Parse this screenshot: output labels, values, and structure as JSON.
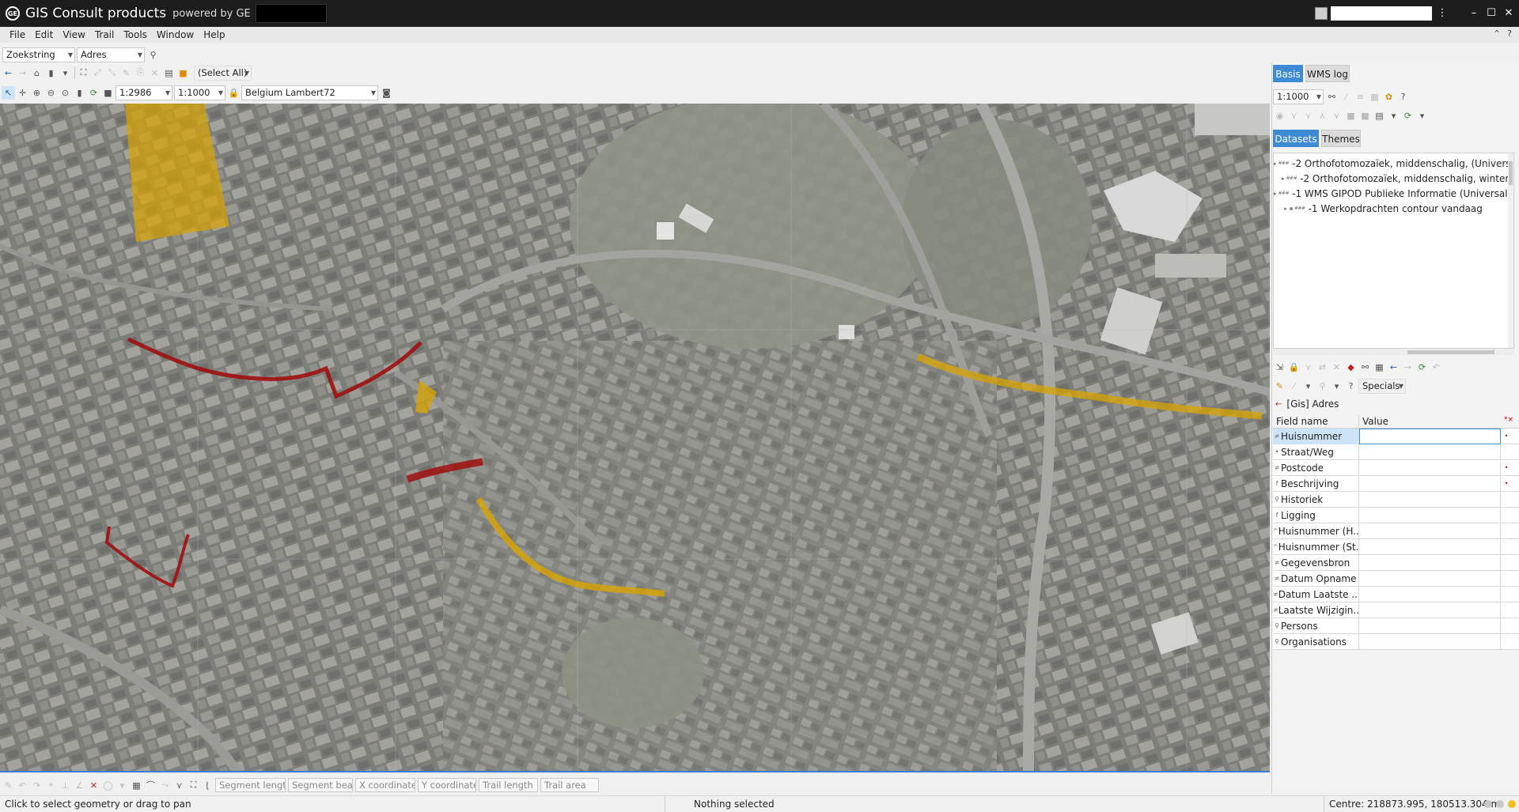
{
  "titlebar": {
    "app_title": "GIS Consult products",
    "powered_by": "powered by GE",
    "logo_text": "GE"
  },
  "menu": [
    "File",
    "Edit",
    "View",
    "Trail",
    "Tools",
    "Window",
    "Help"
  ],
  "search": {
    "field_value": "Zoekstring",
    "type_value": "Adres"
  },
  "toolbar": {
    "select_all": "(Select All)",
    "scale_value": "1:2986",
    "scale_preset": "1:1000",
    "crs": "Belgium Lambert72"
  },
  "bottom_toolbar": {
    "segment_length": "Segment lengtl",
    "segment_bearing": "Segment beari",
    "x_coordinate": "X coordinate",
    "y_coordinate": "Y coordinate",
    "trail_length": "Trail length",
    "trail_area": "Trail area"
  },
  "statusbar": {
    "hint": "Click to select geometry or drag to pan",
    "selection": "Nothing selected",
    "center": "Centre: 218873.995, 180513.304 m"
  },
  "right_panel": {
    "tabs": [
      "Basis",
      "WMS log"
    ],
    "scale": "1:1000",
    "subtabs": [
      "Datasets",
      "Themes"
    ],
    "tree_items": [
      {
        "label": "-2 Orthofotomozaïek, middenschalig, (Universal",
        "level": 0
      },
      {
        "label": "-2 Orthofotomozaïek, middenschalig, winterop",
        "level": 1
      },
      {
        "label": "-1 WMS GIPOD Publieke Informatie (Universal D",
        "level": 0
      },
      {
        "label": "-1 Werkopdrachten contour vandaag",
        "level": 1
      }
    ],
    "specials": "Specials",
    "form_title": "[Gis] Adres",
    "grid_headers": {
      "field": "Field name",
      "value": "Value"
    },
    "fields": [
      {
        "name": "Huisnummer",
        "icon": "≠",
        "required": true
      },
      {
        "name": "Straat/Weg",
        "icon": "•",
        "required": false
      },
      {
        "name": "Postcode",
        "icon": "≠",
        "required": true
      },
      {
        "name": "Beschrijving",
        "icon": "f",
        "required": true
      },
      {
        "name": "Historiek",
        "icon": "⚲",
        "required": false
      },
      {
        "name": "Ligging",
        "icon": "f",
        "required": false
      },
      {
        "name": "Huisnummer (H...",
        "icon": "^",
        "required": false
      },
      {
        "name": "Huisnummer (St...",
        "icon": "^",
        "required": false
      },
      {
        "name": "Gegevensbron",
        "icon": "≠",
        "required": false
      },
      {
        "name": "Datum Opname",
        "icon": "≠",
        "required": false
      },
      {
        "name": "Datum Laatste ...",
        "icon": "≠",
        "required": false
      },
      {
        "name": "Laatste Wijzigin...",
        "icon": "≠",
        "required": false
      },
      {
        "name": "Persons",
        "icon": "⚲",
        "required": false
      },
      {
        "name": "Organisations",
        "icon": "⚲",
        "required": false
      }
    ]
  },
  "colors": {
    "accent": "#3d8ad5",
    "title_bg": "#1d1d1d",
    "route_red": "#a01010",
    "route_yellow": "#d9a400"
  }
}
